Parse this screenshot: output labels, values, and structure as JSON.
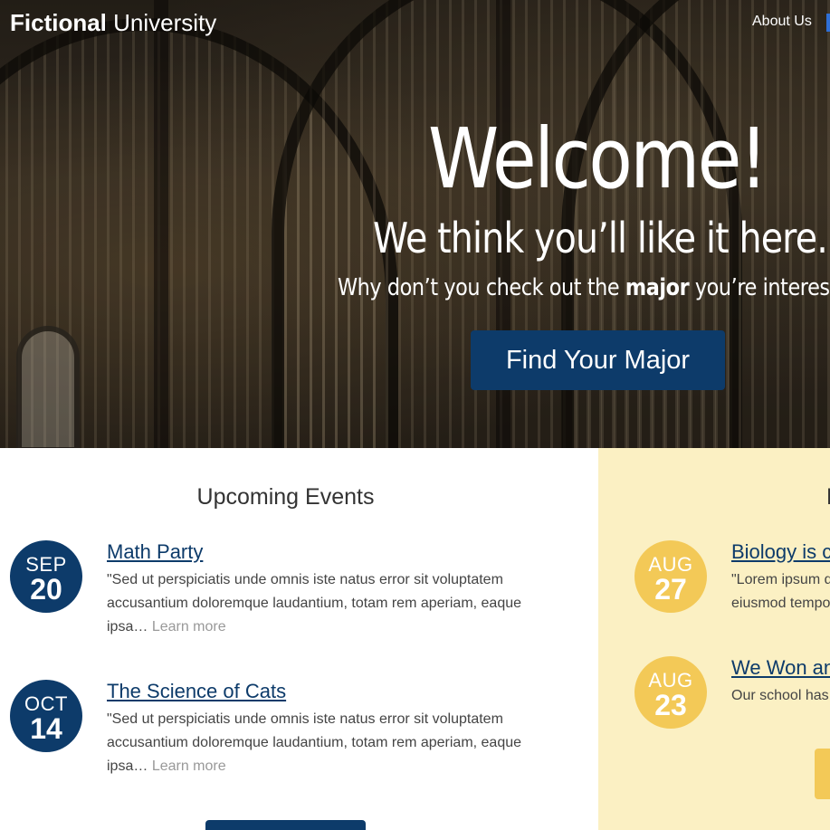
{
  "header": {
    "logo_bold": "Fictional",
    "logo_light": "University",
    "nav": [
      {
        "label": "About Us"
      }
    ]
  },
  "hero": {
    "title": "Welcome!",
    "subtitle": "We think you’ll like it here.",
    "line_before": "Why don’t you check out the ",
    "line_bold": "major",
    "line_after": " you’re interested",
    "cta_label": "Find Your Major"
  },
  "events": {
    "heading": "Upcoming Events",
    "items": [
      {
        "month": "SEP",
        "day": "20",
        "title": "Math Party",
        "excerpt": "\"Sed ut perspiciatis unde omnis iste natus error sit voluptatem accusantium doloremque laudantium, totam rem aperiam, eaque ipsa…",
        "learn_more": "Learn more"
      },
      {
        "month": "OCT",
        "day": "14",
        "title": "The Science of Cats",
        "excerpt": "\"Sed ut perspiciatis unde omnis iste natus error sit voluptatem accusantium doloremque laudantium, totam rem aperiam, eaque ipsa…",
        "learn_more": "Learn more"
      }
    ]
  },
  "blog": {
    "heading_fragment": "F",
    "items": [
      {
        "month": "AUG",
        "day": "27",
        "title": "Biology is c",
        "line1": "\"Lorem ipsum d",
        "line2": "eiusmod tempo"
      },
      {
        "month": "AUG",
        "day": "23",
        "title": "We Won an",
        "line1": "Our school has"
      }
    ]
  },
  "colors": {
    "navy": "#0d3b6a",
    "gold": "#f3c957",
    "panel": "#fbf0c3"
  }
}
